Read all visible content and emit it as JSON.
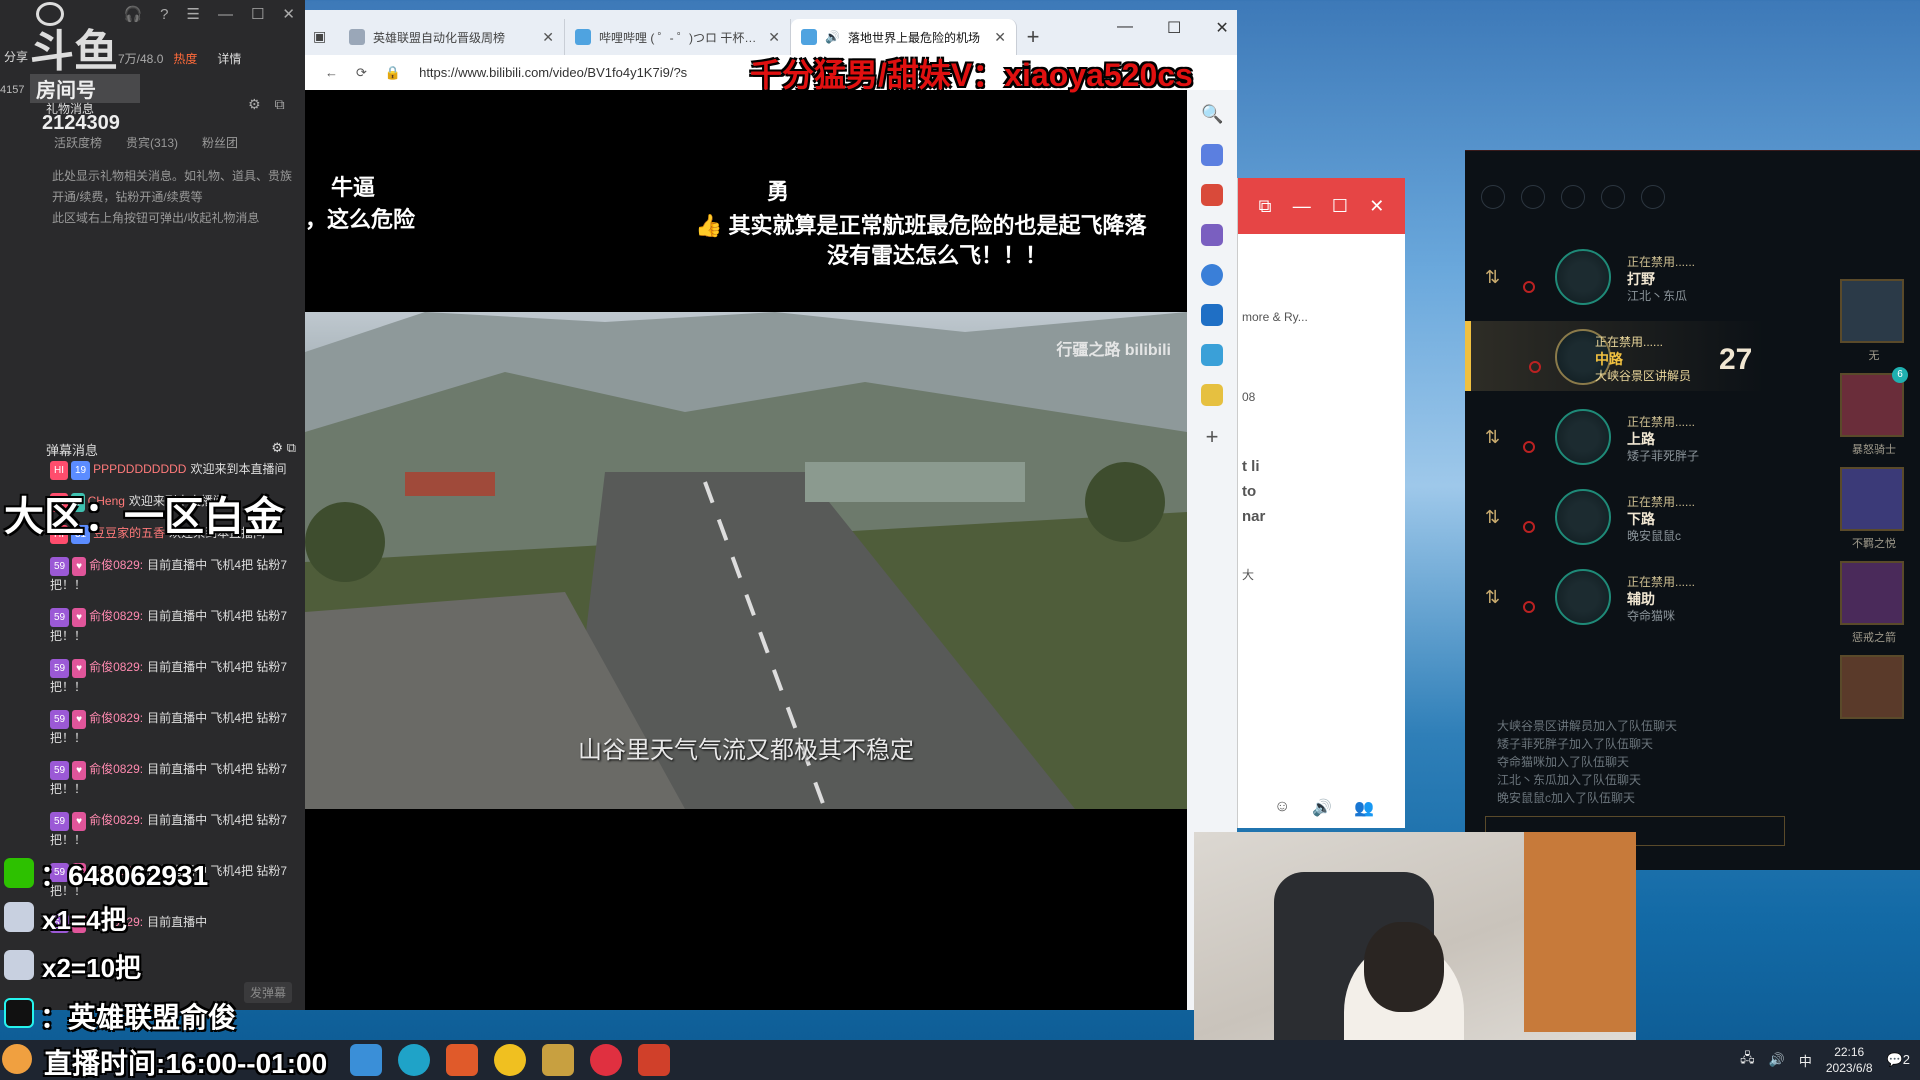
{
  "douyu": {
    "logo_text": "斗鱼",
    "room_label": "房间号",
    "share_label": "分享",
    "left_number": "4157",
    "viewers": "7万/48.0",
    "hot_label": "热度",
    "detail_label": "详情",
    "room_id": "2124309",
    "gift_title": "礼物消息",
    "tabs": [
      "活跃度榜",
      "贵宾(313)",
      "粉丝团"
    ],
    "gift_info": [
      "此处显示礼物相关消息。如礼物、道具、贵族",
      "开通/续费，钻粉开通/续费等",
      "此区域右上角按钮可弹出/收起礼物消息"
    ],
    "danmu_title": "弹幕消息",
    "danmu": [
      {
        "badges": [
          "HI",
          "19"
        ],
        "user": "PPPDDDDDDDD",
        "text": "欢迎来到本直播间"
      },
      {
        "badges": [
          "HI",
          "6"
        ],
        "user": "CHeng",
        "text": "欢迎来到本直播间"
      },
      {
        "badges": [
          "HI",
          "31"
        ],
        "user": "豆豆家的五香",
        "text": "欢迎来到本直播间"
      },
      {
        "badges": [
          "59",
          "♥"
        ],
        "user": "俞俊0829:",
        "text": "目前直播中 飞机4把 钻粉7把！！"
      },
      {
        "badges": [
          "59",
          "♥"
        ],
        "user": "俞俊0829:",
        "text": "目前直播中 飞机4把 钻粉7把！！"
      },
      {
        "badges": [
          "59",
          "♥"
        ],
        "user": "俞俊0829:",
        "text": "目前直播中 飞机4把 钻粉7把！！"
      },
      {
        "badges": [
          "59",
          "♥"
        ],
        "user": "俞俊0829:",
        "text": "目前直播中 飞机4把 钻粉7把！！"
      },
      {
        "badges": [
          "59",
          "♥"
        ],
        "user": "俞俊0829:",
        "text": "目前直播中 飞机4把 钻粉7把！！"
      },
      {
        "badges": [
          "59",
          "♥"
        ],
        "user": "俞俊0829:",
        "text": "目前直播中 飞机4把 钻粉7把！！"
      },
      {
        "badges": [
          "59",
          "♥"
        ],
        "user": "俞俊0829:",
        "text": "目前直播中 飞机4把 钻粉7把！！"
      },
      {
        "badges": [
          "59",
          "♥"
        ],
        "user": "俞俊0829:",
        "text": "目前直播中"
      }
    ],
    "send_label": "发弹幕"
  },
  "overlays": {
    "region": "大区：一区白金",
    "wechat": "：648062931",
    "price1": "x1=4把",
    "price2": "x2=10把",
    "tiktok": "：英雄联盟俞俊",
    "live_time": "直播时间:16:00--01:00"
  },
  "browser": {
    "tabs": [
      {
        "title": "英雄联盟自动化晋级周榜",
        "active": false
      },
      {
        "title": "哔哩哔哩 ( ゜- ゜)つロ 干杯~-b",
        "active": false
      },
      {
        "title": "落地世界上最危险的机场",
        "active": true
      }
    ],
    "url": "https://www.bilibili.com/video/BV1fo4y1K7i9/?s",
    "danmaku": [
      "牛逼",
      "，这么危险",
      "勇",
      "👍 其实就算是正常航班最危险的也是起飞降落",
      "没有雷达怎么飞！！！"
    ],
    "promo": "千分猛男/甜妹V：xiaoya520cs",
    "watermark": "行疆之路 bilibili",
    "subtitle": "山谷里天气气流又都极其不稳定"
  },
  "whitewin": {
    "snippets": [
      "more & Ry...",
      "08",
      "t li",
      "to",
      "nar",
      "大"
    ]
  },
  "lol": {
    "lanes": [
      {
        "state": "正在禁用......",
        "role": "打野",
        "player": "江北丶东瓜",
        "active": false
      },
      {
        "state": "正在禁用......",
        "role": "中路",
        "player": "大峡谷景区讲解员",
        "active": true
      },
      {
        "state": "正在禁用......",
        "role": "上路",
        "player": "矮子菲死胖子",
        "active": false
      },
      {
        "state": "正在禁用......",
        "role": "下路",
        "player": "晚安鼠鼠c",
        "active": false
      },
      {
        "state": "正在禁用......",
        "role": "辅助",
        "player": "夺命猫咪",
        "active": false
      }
    ],
    "timer": "27",
    "champs": [
      "无",
      "暴怒骑士",
      "不羁之悦",
      "惩戒之箭",
      ""
    ],
    "champ_badge": "6",
    "log": [
      "大峡谷景区讲解员加入了队伍聊天",
      "矮子菲死胖子加入了队伍聊天",
      "夺命猫咪加入了队伍聊天",
      "江北丶东瓜加入了队伍聊天",
      "晚安鼠鼠c加入了队伍聊天"
    ]
  },
  "taskbar": {
    "time": "22:16",
    "date": "2023/6/8",
    "ime": "中",
    "notif_count": "2"
  }
}
